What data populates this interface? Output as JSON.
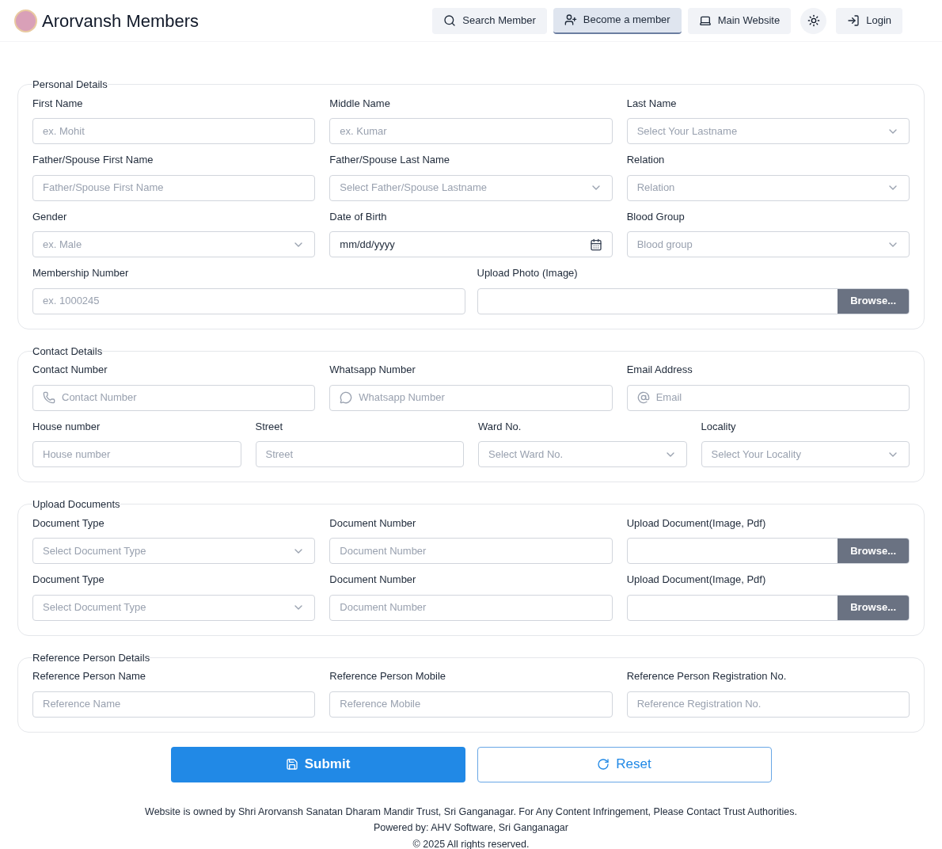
{
  "header": {
    "title": "Arorvansh Members",
    "nav": [
      {
        "label": "Search Member",
        "kind": "search",
        "selected": false
      },
      {
        "label": "Become a member",
        "kind": "join",
        "selected": true
      },
      {
        "label": "Main Website",
        "kind": "website",
        "selected": false
      },
      {
        "kind": "theme",
        "selected": false
      },
      {
        "label": "Login",
        "kind": "login",
        "selected": false
      }
    ]
  },
  "sections": [
    {
      "title": "Personal Details",
      "rows": [
        [
          {
            "label": "First Name",
            "kind": "text",
            "placeholder": "ex. Mohit"
          },
          {
            "label": "Middle Name",
            "kind": "text",
            "placeholder": "ex. Kumar"
          },
          {
            "label": "Last Name",
            "kind": "select",
            "placeholder": "Select Your Lastname"
          }
        ],
        [
          {
            "label": "Father/Spouse First Name",
            "kind": "text",
            "placeholder": "Father/Spouse First Name"
          },
          {
            "label": "Father/Spouse Last Name",
            "kind": "select",
            "placeholder": "Select Father/Spouse Lastname"
          },
          {
            "label": "Relation",
            "kind": "select",
            "placeholder": "Relation"
          }
        ],
        [
          {
            "label": "Gender",
            "kind": "select",
            "placeholder": "ex. Male"
          },
          {
            "label": "Date of Birth",
            "kind": "date",
            "value": "mm/dd/yyyy"
          },
          {
            "label": "Blood Group",
            "kind": "select",
            "placeholder": "Blood group"
          }
        ]
      ],
      "wide_fields": [
        {
          "label": "Membership Number",
          "kind": "text",
          "placeholder": "ex. 1000245"
        },
        {
          "label": "Upload Photo (Image)",
          "kind": "file",
          "button": "Browse..."
        }
      ]
    },
    {
      "title": "Contact Details",
      "rows": [
        [
          {
            "label": "Contact Number",
            "kind": "phone",
            "placeholder": "Contact Number"
          },
          {
            "label": "Whatsapp Number",
            "kind": "whatsapp",
            "placeholder": "Whatsapp Number"
          },
          {
            "label": "Email Address",
            "kind": "email",
            "placeholder": "Email"
          }
        ],
        [
          {
            "label": "House number",
            "kind": "text",
            "placeholder": "House number"
          },
          {
            "label": "Street",
            "kind": "text",
            "placeholder": "Street"
          },
          {
            "label": "Ward No.",
            "kind": "select",
            "placeholder": "Select Ward No."
          },
          {
            "label": "Locality",
            "kind": "select",
            "placeholder": "Select Your Locality"
          }
        ]
      ]
    },
    {
      "title": "Upload Documents",
      "rows": [
        [
          {
            "label": "Document Type",
            "kind": "select",
            "placeholder": "Select Document Type"
          },
          {
            "label": "Document Number",
            "kind": "text",
            "placeholder": "Document Number"
          },
          {
            "label": "Upload Document(Image, Pdf)",
            "kind": "file",
            "button": "Browse..."
          }
        ],
        [
          {
            "label": "Document Type",
            "kind": "select",
            "placeholder": "Select Document Type"
          },
          {
            "label": "Document Number",
            "kind": "text",
            "placeholder": "Document Number"
          },
          {
            "label": "Upload Document(Image, Pdf)",
            "kind": "file",
            "button": "Browse..."
          }
        ]
      ]
    },
    {
      "title": "Reference Person Details",
      "rows": [
        [
          {
            "label": "Reference Person Name",
            "kind": "text",
            "placeholder": "Reference Name"
          },
          {
            "label": "Reference Person Mobile",
            "kind": "text",
            "placeholder": "Reference Mobile"
          },
          {
            "label": "Reference Person Registration No.",
            "kind": "text",
            "placeholder": "Reference Registration No."
          }
        ]
      ]
    }
  ],
  "actions": [
    {
      "label": "Submit",
      "kind": "primary"
    },
    {
      "label": "Reset",
      "kind": "secondary"
    }
  ],
  "footer": [
    "Website is owned by Shri Arorvansh Sanatan Dharam Mandir Trust, Sri Ganganagar. For Any Content Infringement, Please Contact Trust Authorities.",
    "Powered by: AHV Software, Sri Ganganagar",
    "© 2025 All rights reserved."
  ]
}
